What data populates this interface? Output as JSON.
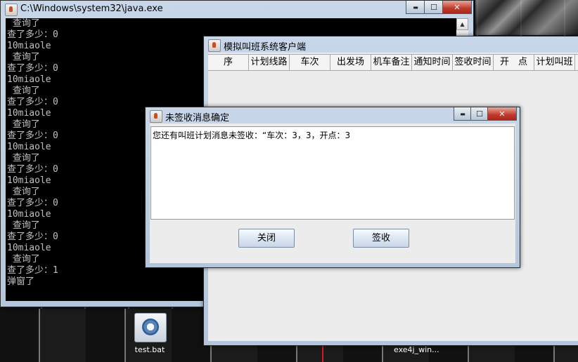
{
  "console": {
    "title": "C:\\Windows\\system32\\java.exe",
    "lines": [
      " 查询了",
      "查了多少：0",
      "10miaole",
      " 查询了",
      "查了多少：0",
      "10miaole",
      " 查询了",
      "查了多少：0",
      "10miaole",
      " 查询了",
      "查了多少：0",
      "10miaole",
      " 查询了",
      "查了多少：0",
      "10miaole",
      " 查询了",
      "查了多少：0",
      "10miaole",
      " 查询了",
      "查了多少：0",
      "10miaole",
      " 查询了",
      "查了多少：1",
      "弹窗了"
    ]
  },
  "client": {
    "title": "模拟叫班系统客户端",
    "columns": [
      "序",
      "计划线路",
      "车次",
      "出发场",
      "机车备注",
      "通知时间",
      "签收时间",
      "开　点",
      "计划叫班"
    ]
  },
  "dialog": {
    "title": "未签收消息确定",
    "message": "您还有叫班计划消息未签收：“车次：3，3，开点：3",
    "close_label": "关闭",
    "sign_label": "签收"
  },
  "desktop": {
    "icon_label": "test.bat",
    "taskbar_label": "exe4j_win..."
  },
  "captions": {
    "minimize": "▬",
    "maximize": "☐",
    "close": "✕"
  },
  "colors": {
    "console_bg": "#000000",
    "console_text": "#c0c0c0",
    "close_red": "#c0392b"
  }
}
